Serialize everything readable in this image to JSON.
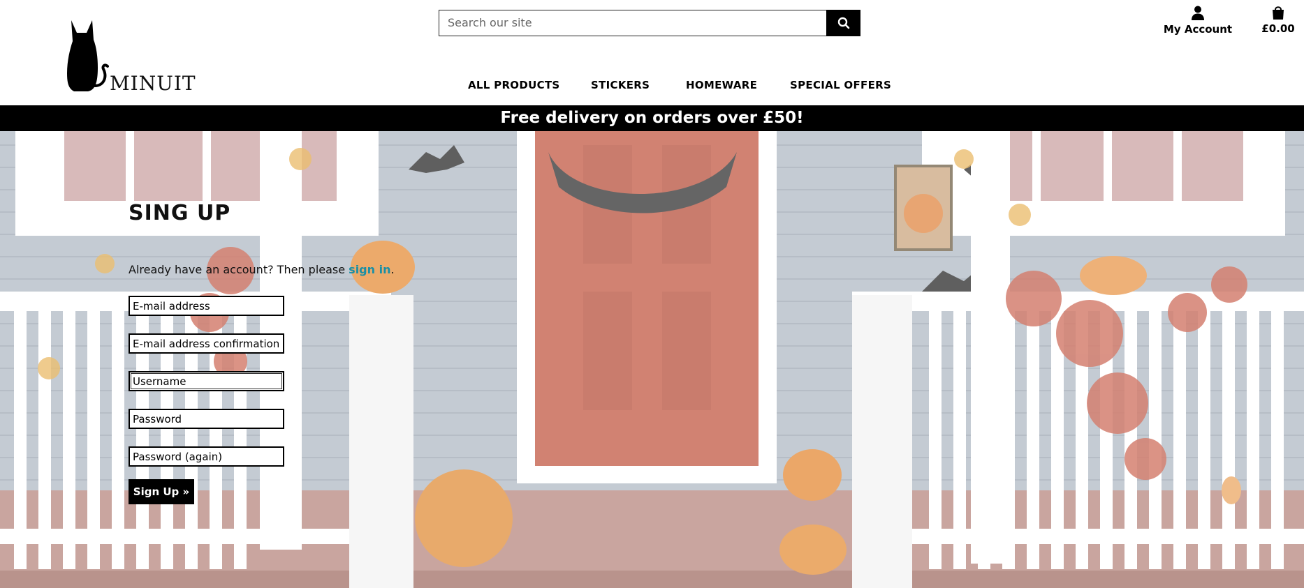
{
  "brand": {
    "name": "MINUIT"
  },
  "search": {
    "placeholder": "Search our site"
  },
  "header": {
    "account_label": "My Account",
    "cart_total": "£0.00"
  },
  "nav": {
    "items": [
      "ALL PRODUCTS",
      "STICKERS",
      "HOMEWARE",
      "SPECIAL OFFERS"
    ]
  },
  "banner": {
    "text": "Free delivery on orders over £50!"
  },
  "signup": {
    "title": "SING UP",
    "lead_text": "Already have an account? Then please ",
    "signin_link": "sign in",
    "lead_end": ".",
    "fields": [
      {
        "placeholder": "E-mail address"
      },
      {
        "placeholder": "E-mail address confirmation"
      },
      {
        "placeholder": "Username"
      },
      {
        "placeholder": "Password"
      },
      {
        "placeholder": "Password (again)"
      }
    ],
    "submit_label": "Sign Up »"
  },
  "colors": {
    "link": "#1a8fa5",
    "banner_bg": "#000000",
    "door": "#c0523c",
    "pumpkin": "#e07a2c"
  },
  "icons": [
    "cat-logo-icon",
    "search-icon",
    "user-icon",
    "shopping-bag-icon"
  ]
}
